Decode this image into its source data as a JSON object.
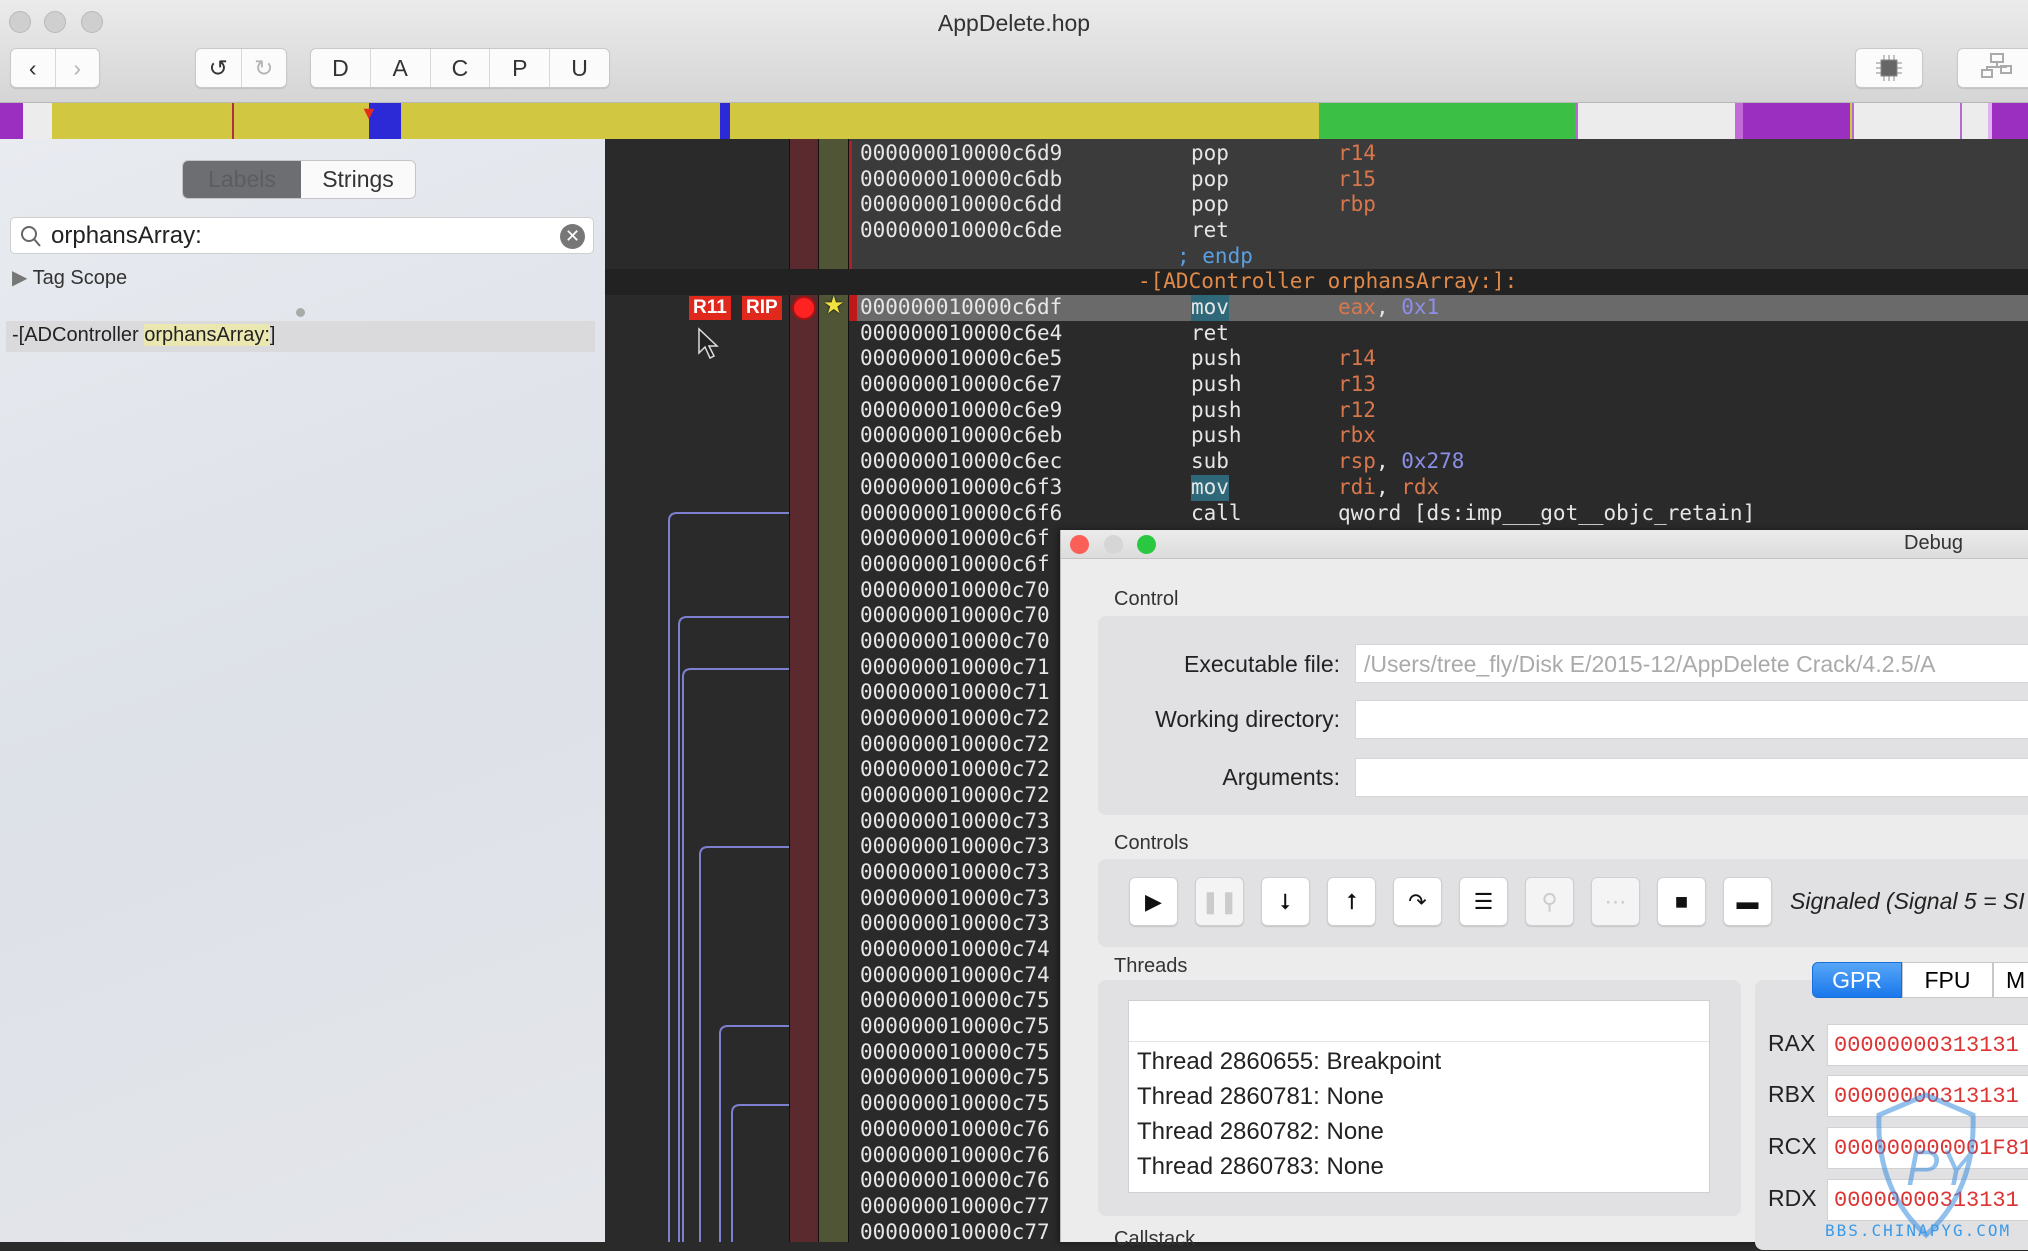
{
  "window": {
    "title": "AppDelete.hop"
  },
  "toolbar": {
    "back": "‹",
    "forward": "›",
    "undo": "↺",
    "redo": "↻",
    "modes": [
      "D",
      "A",
      "C",
      "P",
      "U"
    ],
    "cpu_icon": "cpu-icon",
    "graph_icon": "flowchart-icon"
  },
  "navbar": {
    "colors": {
      "code": "#d1c740",
      "procedure": "#2c2ad6",
      "external": "#9b30c0",
      "data": "#3cbf45",
      "unexplored": "#ececec"
    }
  },
  "sidebar": {
    "tabs": [
      "Labels",
      "Strings"
    ],
    "active_tab": "Labels",
    "search_value": "orphansArray:",
    "tag_scope": "Tag Scope",
    "result_prefix": "-[ADController ",
    "result_match": "orphansArray:",
    "result_suffix": "]"
  },
  "code": {
    "markers": [
      "R11",
      "RIP"
    ],
    "endp": "; endp",
    "proc_header": "-[ADController orphansArray:]:",
    "rows": [
      {
        "addr": "000000010000c6d9",
        "mn": "pop",
        "op": "r14"
      },
      {
        "addr": "000000010000c6db",
        "mn": "pop",
        "op": "r15"
      },
      {
        "addr": "000000010000c6dd",
        "mn": "pop",
        "op": "rbp"
      },
      {
        "addr": "000000010000c6de",
        "mn": "ret",
        "op": ""
      },
      {
        "addr": "000000010000c6df",
        "mn": "mov",
        "op": "eax, 0x1"
      },
      {
        "addr": "000000010000c6e4",
        "mn": "ret",
        "op": ""
      },
      {
        "addr": "000000010000c6e5",
        "mn": "push",
        "op": "r14"
      },
      {
        "addr": "000000010000c6e7",
        "mn": "push",
        "op": "r13"
      },
      {
        "addr": "000000010000c6e9",
        "mn": "push",
        "op": "r12"
      },
      {
        "addr": "000000010000c6eb",
        "mn": "push",
        "op": "rbx"
      },
      {
        "addr": "000000010000c6ec",
        "mn": "sub",
        "op": "rsp, 0x278"
      },
      {
        "addr": "000000010000c6f3",
        "mn": "mov",
        "op": "rdi, rdx"
      },
      {
        "addr": "000000010000c6f6",
        "mn": "call",
        "op": "qword [ds:imp___got__objc_retain]"
      }
    ],
    "truncated_rows": [
      "000000010000c6f",
      "000000010000c6f",
      "000000010000c70",
      "000000010000c70",
      "000000010000c70",
      "000000010000c71",
      "000000010000c71",
      "000000010000c72",
      "000000010000c72",
      "000000010000c72",
      "000000010000c72",
      "000000010000c73",
      "000000010000c73",
      "000000010000c73",
      "000000010000c73",
      "000000010000c73",
      "000000010000c74",
      "000000010000c74",
      "000000010000c75",
      "000000010000c75",
      "000000010000c75",
      "000000010000c75",
      "000000010000c75",
      "000000010000c76",
      "000000010000c76",
      "000000010000c76",
      "000000010000c77",
      "000000010000c77"
    ]
  },
  "debug": {
    "title": "Debug",
    "control_label": "Control",
    "executable_label": "Executable file:",
    "executable_value": "/Users/tree_fly/Disk E/2015-12/AppDelete Crack/4.2.5/A",
    "workdir_label": "Working directory:",
    "workdir_value": "",
    "arguments_label": "Arguments:",
    "arguments_value": "",
    "controls_label": "Controls",
    "buttons": [
      {
        "name": "continue",
        "glyph": "▶",
        "enabled": true
      },
      {
        "name": "pause",
        "glyph": "❚❚",
        "enabled": false
      },
      {
        "name": "step-into",
        "glyph": "⭣",
        "enabled": true
      },
      {
        "name": "step-out",
        "glyph": "⭡",
        "enabled": true
      },
      {
        "name": "step-over",
        "glyph": "↷",
        "enabled": true
      },
      {
        "name": "step-instruction",
        "glyph": "☰",
        "enabled": true
      },
      {
        "name": "attach",
        "glyph": "⚲",
        "enabled": false
      },
      {
        "name": "detach",
        "glyph": "⋯",
        "enabled": false
      },
      {
        "name": "stop",
        "glyph": "■",
        "enabled": true
      },
      {
        "name": "kill",
        "glyph": "▬",
        "enabled": true
      }
    ],
    "status": "Signaled (Signal 5 = SI",
    "threads_label": "Threads",
    "threads": [
      "Thread 2860655: Breakpoint",
      "Thread 2860781: None",
      "Thread 2860782: None",
      "Thread 2860783: None"
    ],
    "callstack_label": "Callstack",
    "reg_tabs": [
      "GPR",
      "FPU",
      "M"
    ],
    "active_reg_tab": "GPR",
    "registers": [
      {
        "name": "RAX",
        "value": "00000000313131"
      },
      {
        "name": "RBX",
        "value": "00000000313131"
      },
      {
        "name": "RCX",
        "value": "000000000001F81"
      },
      {
        "name": "RDX",
        "value": "00000000313131"
      }
    ]
  },
  "watermark": "BBS.CHINAPYG.COM"
}
